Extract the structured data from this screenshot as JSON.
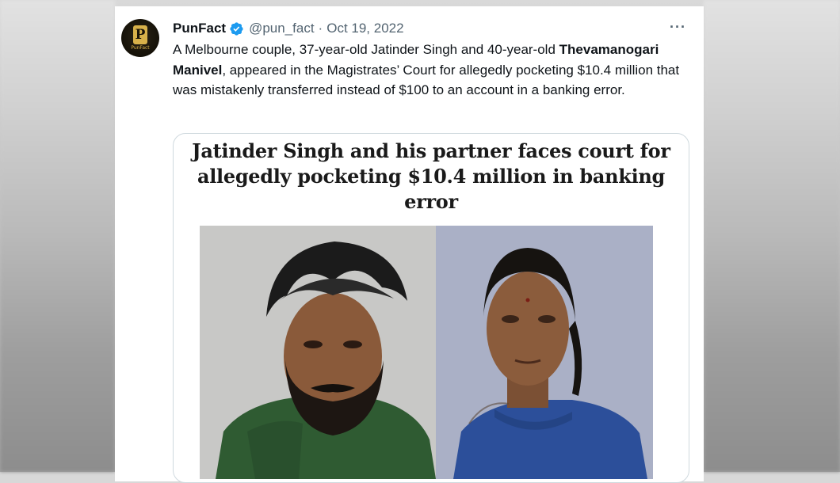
{
  "tweet": {
    "author_name": "PunFact",
    "author_handle": "@pun_fact",
    "separator": "·",
    "date": "Oct 19, 2022",
    "more_label": "···",
    "avatar_letter": "P",
    "avatar_wordmark": "PunFact",
    "text_part1": "A Melbourne couple, 37-year-old Jatinder Singh and 40-year-old ",
    "text_bold": "Thevamanogari Manivel",
    "text_part2": ", appeared in the Magistrates’ Court for allegedly pocketing $10.4 million that was mistakenly transferred instead of $100 to an account in a banking error."
  },
  "media": {
    "headline": "Jatinder Singh and his partner faces court for allegedly pocketing $10.4 million in banking error"
  },
  "colors": {
    "verified_blue": "#1d9bf0",
    "text_primary": "#0f1419",
    "text_secondary": "#536471"
  }
}
